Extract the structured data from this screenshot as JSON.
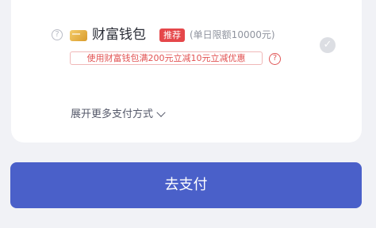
{
  "payment_method": {
    "help_icon": "question-icon",
    "wallet_icon": "wallet-card-icon",
    "name": "财富钱包",
    "badge": "推荐",
    "limit": "(单日限额10000元)",
    "promo": "使用财富钱包满200元立减10元立减优惠",
    "promo_help_icon": "question-icon",
    "selected_icon": "check-icon",
    "help_glyph": "?",
    "check_glyph": "✓"
  },
  "expand": {
    "label": "展开更多支付方式",
    "icon": "chevron-down-icon"
  },
  "pay_button": {
    "label": "去支付"
  },
  "colors": {
    "background": "#f1f2f6",
    "card": "#ffffff",
    "primary": "#4a60c9",
    "badge": "#e5474a",
    "promo": "#e25252"
  }
}
